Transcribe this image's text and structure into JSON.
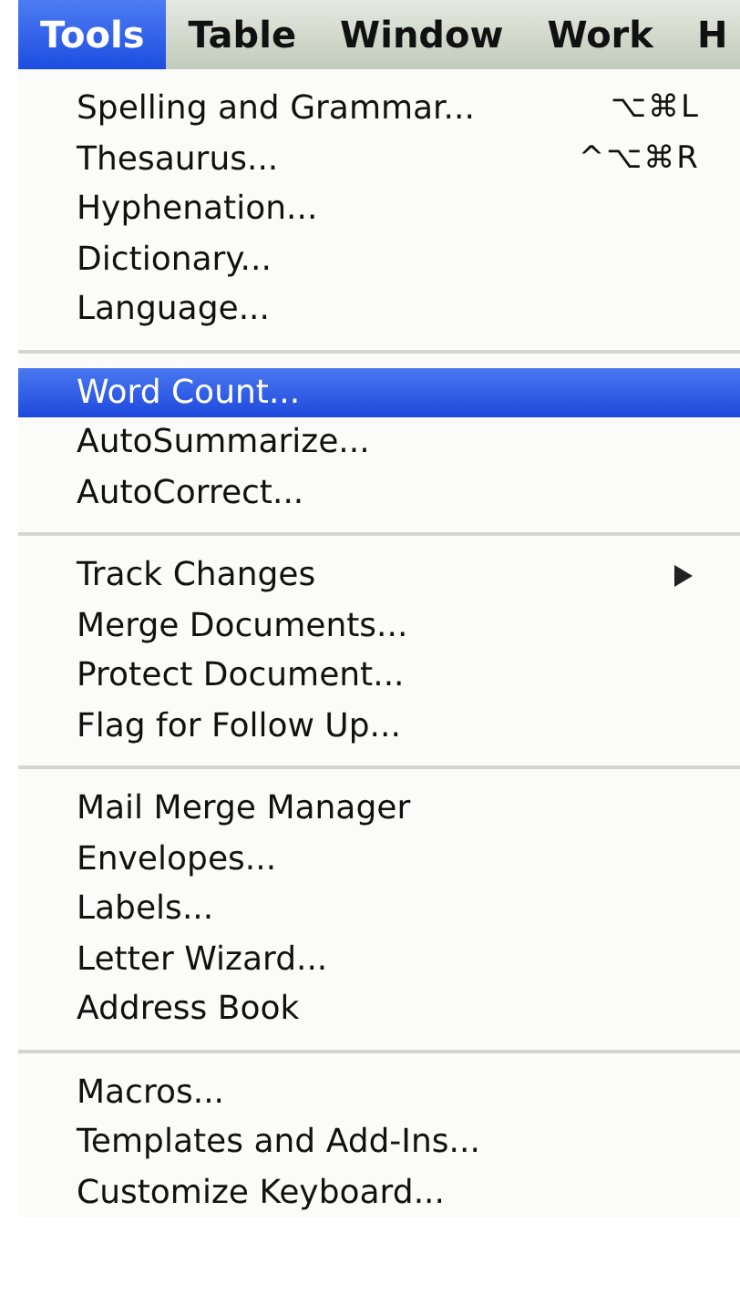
{
  "menu_bar": [
    {
      "label": "Tools",
      "selected": true
    },
    {
      "label": "Table",
      "selected": false
    },
    {
      "label": "Window",
      "selected": false
    },
    {
      "label": "Work",
      "selected": false
    },
    {
      "label": "H",
      "selected": false
    }
  ],
  "menu": {
    "groups": [
      [
        {
          "label": "Spelling and Grammar...",
          "shortcut": "⌥⌘L",
          "submenu": false,
          "selected": false
        },
        {
          "label": "Thesaurus...",
          "shortcut": "^⌥⌘R",
          "submenu": false,
          "selected": false
        },
        {
          "label": "Hyphenation...",
          "submenu": false,
          "selected": false
        },
        {
          "label": "Dictionary...",
          "submenu": false,
          "selected": false
        },
        {
          "label": "Language...",
          "submenu": false,
          "selected": false
        }
      ],
      [
        {
          "label": "Word Count...",
          "submenu": false,
          "selected": true
        },
        {
          "label": "AutoSummarize...",
          "submenu": false,
          "selected": false
        },
        {
          "label": "AutoCorrect...",
          "submenu": false,
          "selected": false
        }
      ],
      [
        {
          "label": "Track Changes",
          "submenu": true,
          "selected": false
        },
        {
          "label": "Merge Documents...",
          "submenu": false,
          "selected": false
        },
        {
          "label": "Protect Document...",
          "submenu": false,
          "selected": false
        },
        {
          "label": "Flag for Follow Up...",
          "submenu": false,
          "selected": false
        }
      ],
      [
        {
          "label": "Mail Merge Manager",
          "submenu": false,
          "selected": false
        },
        {
          "label": "Envelopes...",
          "submenu": false,
          "selected": false
        },
        {
          "label": "Labels...",
          "submenu": false,
          "selected": false
        },
        {
          "label": "Letter Wizard...",
          "submenu": false,
          "selected": false
        },
        {
          "label": "Address Book",
          "submenu": false,
          "selected": false
        }
      ],
      [
        {
          "label": "Macros...",
          "submenu": false,
          "selected": false
        },
        {
          "label": "Templates and Add-Ins...",
          "submenu": false,
          "selected": false
        },
        {
          "label": "Customize Keyboard...",
          "submenu": false,
          "selected": false
        }
      ]
    ]
  }
}
